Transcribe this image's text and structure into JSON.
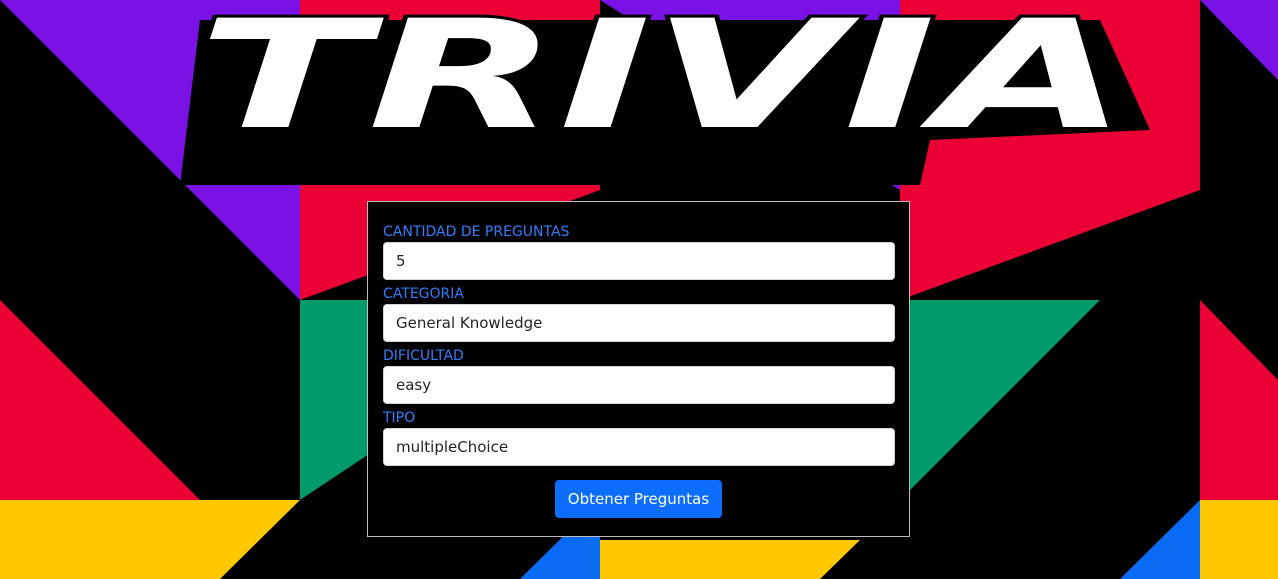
{
  "app": {
    "logo_text": "TRIVIA"
  },
  "form": {
    "fields": [
      {
        "label": "CANTIDAD DE PREGUNTAS",
        "value": "5"
      },
      {
        "label": "CATEGORIA",
        "value": "General Knowledge"
      },
      {
        "label": "DIFICULTAD",
        "value": "easy"
      },
      {
        "label": "TIPO",
        "value": "multipleChoice"
      }
    ],
    "submit_label": "Obtener Preguntas"
  },
  "colors": {
    "purple": "#7a12e6",
    "red": "#ea0035",
    "green": "#019b6b",
    "yellow": "#ffc800",
    "blue": "#0a6cf5",
    "label_blue": "#2f7fff",
    "button_blue": "#0d6efd"
  }
}
